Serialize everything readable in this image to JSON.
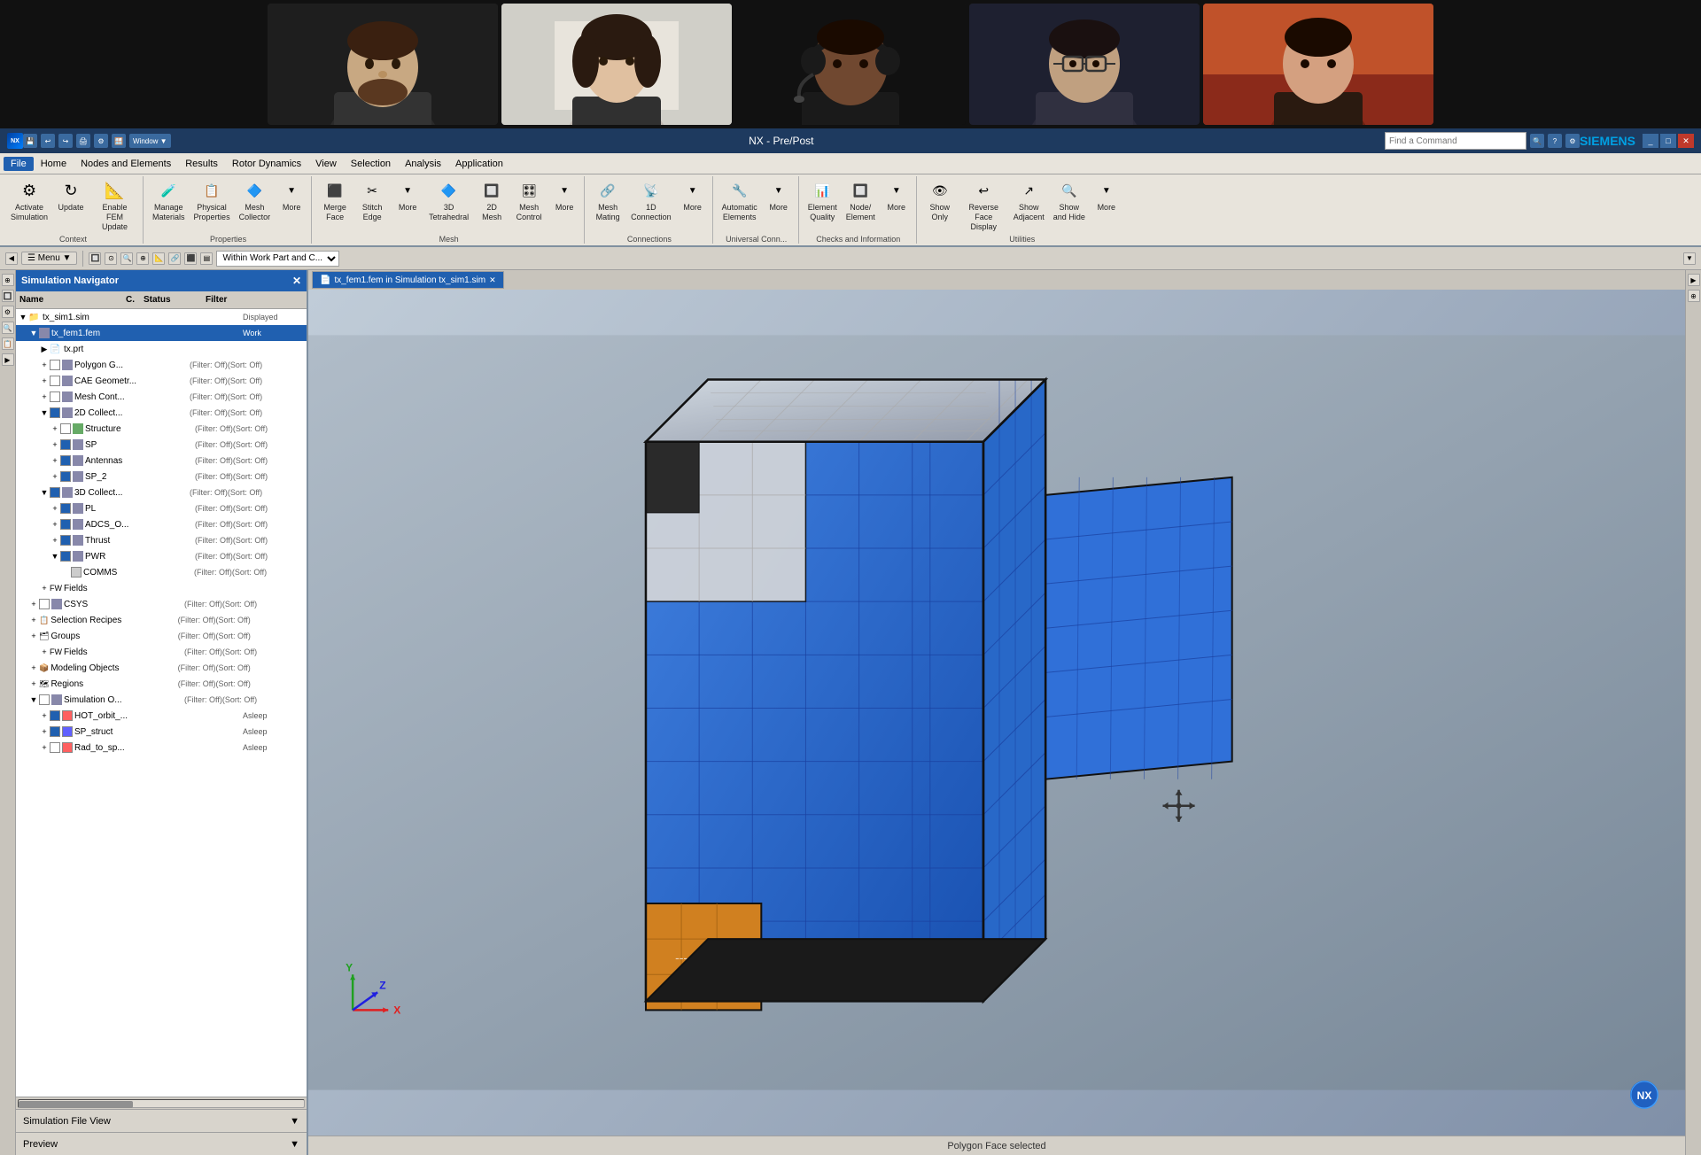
{
  "app": {
    "title": "NX - Pre/Post",
    "brand": "SIEMENS"
  },
  "video_bar": {
    "tiles": [
      {
        "id": "person1",
        "bg": "#2a2a2a",
        "skin": "#c8a882"
      },
      {
        "id": "person2",
        "bg": "#cccccc",
        "skin": "#e0c0a0"
      },
      {
        "id": "person3",
        "bg": "#1a1a1a",
        "skin": "#805030"
      },
      {
        "id": "person4",
        "bg": "#2a2a2a",
        "skin": "#c0a080"
      },
      {
        "id": "person5",
        "bg": "#c0522a",
        "skin": "#d4a080"
      }
    ]
  },
  "titlebar": {
    "nx_label": "NX",
    "title": "NX - Pre/Post",
    "siemens": "SIEMENS",
    "search_placeholder": "Find a Command",
    "icons": [
      "save",
      "undo",
      "redo",
      "print",
      "settings",
      "window"
    ],
    "window_label": "Window"
  },
  "menubar": {
    "items": [
      "File",
      "Home",
      "Nodes and Elements",
      "Results",
      "Rotor Dynamics",
      "View",
      "Selection",
      "Analysis",
      "Application"
    ]
  },
  "ribbon": {
    "active_tab": "Home",
    "tabs": [
      "File",
      "Home",
      "Nodes and Elements",
      "Results",
      "Rotor Dynamics",
      "View",
      "Selection",
      "Analysis",
      "Application"
    ],
    "groups": [
      {
        "name": "Context",
        "buttons": [
          {
            "icon": "⚙",
            "label": "Activate\nSimulation"
          },
          {
            "icon": "↻",
            "label": "Update"
          },
          {
            "icon": "📐",
            "label": "Enable FEM\nUpdate"
          }
        ]
      },
      {
        "name": "Properties",
        "buttons": [
          {
            "icon": "⚙",
            "label": "Manage\nMaterials"
          },
          {
            "icon": "📋",
            "label": "Physical\nProperties"
          },
          {
            "icon": "🔷",
            "label": "Mesh\nCollector"
          },
          {
            "icon": "▼",
            "label": "More"
          }
        ]
      },
      {
        "name": "Mesh",
        "buttons": [
          {
            "icon": "🔗",
            "label": "Merge\nFace"
          },
          {
            "icon": "✂",
            "label": "Stitch\nEdge"
          },
          {
            "icon": "▼",
            "label": "More"
          },
          {
            "icon": "🔷",
            "label": "3D\nTetrahedral"
          },
          {
            "icon": "🔲",
            "label": "2D\nMesh"
          },
          {
            "icon": "🎛",
            "label": "Mesh\nControl"
          },
          {
            "icon": "▼",
            "label": "More"
          }
        ]
      },
      {
        "name": "Connections",
        "buttons": [
          {
            "icon": "🔗",
            "label": "Mesh\nMating"
          },
          {
            "icon": "📡",
            "label": "1D\nConnection"
          },
          {
            "icon": "▼",
            "label": "More"
          }
        ]
      },
      {
        "name": "Universal Conn...",
        "buttons": [
          {
            "icon": "🔧",
            "label": "Automatic\nElements"
          },
          {
            "icon": "▼",
            "label": "More"
          }
        ]
      },
      {
        "name": "Checks and Information",
        "buttons": [
          {
            "icon": "📊",
            "label": "Element\nQuality"
          },
          {
            "icon": "🔲",
            "label": "Node/\nElement"
          },
          {
            "icon": "▼",
            "label": "More"
          }
        ]
      },
      {
        "name": "Utilities",
        "buttons": [
          {
            "icon": "👁",
            "label": "Show\nOnly"
          },
          {
            "icon": "↩",
            "label": "Reverse\nFace Display"
          },
          {
            "icon": "↗",
            "label": "Show\nAdjacent"
          },
          {
            "icon": "🔍",
            "label": "Show\nand Hide"
          },
          {
            "icon": "▼",
            "label": "More"
          }
        ]
      }
    ]
  },
  "cmdbar": {
    "menu_label": "Menu",
    "filter_label": "Within Work Part and C...",
    "icons": []
  },
  "navigator": {
    "title": "Simulation Navigator",
    "columns": [
      "Name",
      "C.",
      "Status",
      "Filter"
    ],
    "items": [
      {
        "level": 0,
        "name": "tx_sim1.sim",
        "status": "Displayed",
        "filter": "",
        "expanded": true,
        "icon": "sim"
      },
      {
        "level": 1,
        "name": "tx_fem1.fem",
        "status": "Work",
        "filter": "",
        "expanded": true,
        "icon": "fem"
      },
      {
        "level": 2,
        "name": "tx.prt",
        "status": "",
        "filter": "",
        "expanded": false,
        "icon": "prt"
      },
      {
        "level": 2,
        "name": "Polygon G...",
        "status": "",
        "filter": "(Filter: Off)(Sort: Off)",
        "expanded": false,
        "icon": "pg"
      },
      {
        "level": 2,
        "name": "CAE Geometr...",
        "status": "",
        "filter": "(Filter: Off)(Sort: Off)",
        "expanded": false,
        "icon": "cae"
      },
      {
        "level": 2,
        "name": "Mesh Cont...",
        "status": "",
        "filter": "(Filter: Off)(Sort: Off)",
        "expanded": false,
        "icon": "mc"
      },
      {
        "level": 2,
        "name": "2D Collect...",
        "status": "",
        "filter": "(Filter: Off)(Sort: Off)",
        "expanded": true,
        "icon": "2d"
      },
      {
        "level": 3,
        "name": "Structure",
        "status": "",
        "filter": "(Filter: Off)(Sort: Off)",
        "expanded": false,
        "icon": "str"
      },
      {
        "level": 3,
        "name": "SP",
        "status": "",
        "filter": "(Filter: Off)(Sort: Off)",
        "expanded": false,
        "icon": "sp"
      },
      {
        "level": 3,
        "name": "Antennas",
        "status": "",
        "filter": "(Filter: Off)(Sort: Off)",
        "expanded": false,
        "icon": "ant"
      },
      {
        "level": 3,
        "name": "SP_2",
        "status": "",
        "filter": "(Filter: Off)(Sort: Off)",
        "expanded": false,
        "icon": "sp2"
      },
      {
        "level": 2,
        "name": "3D Collect...",
        "status": "",
        "filter": "(Filter: Off)(Sort: Off)",
        "expanded": true,
        "icon": "3d"
      },
      {
        "level": 3,
        "name": "PL",
        "status": "",
        "filter": "(Filter: Off)(Sort: Off)",
        "expanded": false,
        "icon": "pl"
      },
      {
        "level": 3,
        "name": "ADCS_O...",
        "status": "",
        "filter": "(Filter: Off)(Sort: Off)",
        "expanded": false,
        "icon": "adcs"
      },
      {
        "level": 3,
        "name": "Thrust",
        "status": "",
        "filter": "(Filter: Off)(Sort: Off)",
        "expanded": false,
        "icon": "thrust"
      },
      {
        "level": 3,
        "name": "PWR",
        "status": "",
        "filter": "(Filter: Off)(Sort: Off)",
        "expanded": false,
        "icon": "pwr"
      },
      {
        "level": 4,
        "name": "COMMS",
        "status": "",
        "filter": "(Filter: Off)(Sort: Off)",
        "expanded": false,
        "icon": "comms"
      },
      {
        "level": 2,
        "name": "Fields",
        "status": "",
        "filter": "",
        "expanded": false,
        "icon": "fields"
      },
      {
        "level": 1,
        "name": "CSYS",
        "status": "",
        "filter": "(Filter: Off)(Sort: Off)",
        "expanded": false,
        "icon": "csys"
      },
      {
        "level": 1,
        "name": "Selection Recipes",
        "status": "",
        "filter": "(Filter: Off)(Sort: Off)",
        "expanded": false,
        "icon": "sel"
      },
      {
        "level": 1,
        "name": "Groups",
        "status": "",
        "filter": "(Filter: Off)(Sort: Off)",
        "expanded": false,
        "icon": "grp"
      },
      {
        "level": 2,
        "name": "Fields",
        "status": "",
        "filter": "(Filter: Off)(Sort: Off)",
        "expanded": false,
        "icon": "fields"
      },
      {
        "level": 1,
        "name": "Modeling Objects",
        "status": "",
        "filter": "(Filter: Off)(Sort: Off)",
        "expanded": false,
        "icon": "mo"
      },
      {
        "level": 1,
        "name": "Regions",
        "status": "",
        "filter": "(Filter: Off)(Sort: Off)",
        "expanded": false,
        "icon": "reg"
      },
      {
        "level": 1,
        "name": "Simulation O...",
        "status": "",
        "filter": "(Filter: Off)(Sort: Off)",
        "expanded": true,
        "icon": "simo"
      },
      {
        "level": 2,
        "name": "HOT_orbit_...",
        "status": "Asleep",
        "filter": "",
        "expanded": false,
        "icon": "hot",
        "color": "#ff6060"
      },
      {
        "level": 2,
        "name": "SP_struct",
        "status": "Asleep",
        "filter": "",
        "expanded": false,
        "icon": "sps",
        "color": "#6060ff"
      },
      {
        "level": 2,
        "name": "Rad_to_sp...",
        "status": "Asleep",
        "filter": "",
        "expanded": false,
        "icon": "rad",
        "color": "#ff6060"
      }
    ]
  },
  "viewport": {
    "tab_label": "tx_fem1.fem in Simulation tx_sim1.sim",
    "status_text": "Polygon Face selected"
  },
  "panels": {
    "sim_file_view": "Simulation File View",
    "preview": "Preview"
  },
  "colors": {
    "blue_body": "#3060d0",
    "orange_block": "#d08020",
    "dark_frame": "#1a1a1a",
    "light_panel": "#e0e4e8",
    "viewport_bg": "#a0b0c0"
  }
}
